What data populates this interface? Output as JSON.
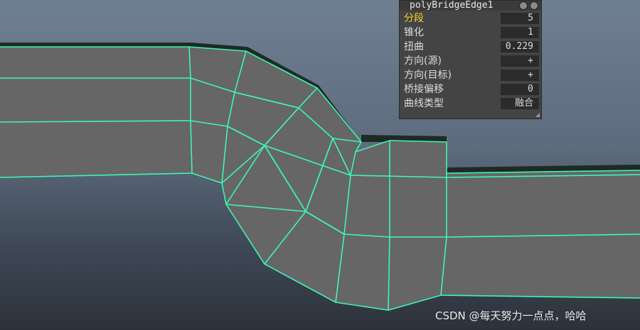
{
  "node_name": "polyBridgeEdge1",
  "attributes": [
    {
      "label": "分段",
      "value": "5",
      "highlighted": true
    },
    {
      "label": "锥化",
      "value": "1",
      "highlighted": false
    },
    {
      "label": "扭曲",
      "value": "0.229",
      "highlighted": false
    },
    {
      "label": "方向(源)",
      "value": "+",
      "highlighted": false
    },
    {
      "label": "方向(目标)",
      "value": "+",
      "highlighted": false
    },
    {
      "label": "桥接偏移",
      "value": "0",
      "highlighted": false
    },
    {
      "label": "曲线类型",
      "value": "融合",
      "highlighted": false
    }
  ],
  "watermark": "CSDN @每天努力一点点，哈哈",
  "colors": {
    "wire": "#3df5b6",
    "face": "#666666",
    "face_dark": "#1f2b25",
    "label_highlight": "#f2d12a"
  }
}
